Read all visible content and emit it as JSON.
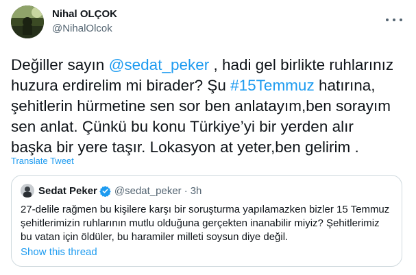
{
  "author": {
    "name": "Nihal OLÇOK",
    "handle": "@NihalOlcok"
  },
  "tweet": {
    "lines": [
      [
        {
          "t": "Değiller sayın ",
          "link": false
        },
        {
          "t": "@sedat_peker",
          "link": true
        },
        {
          "t": " , hadi gel birlikte ruhlarınız",
          "link": false
        }
      ],
      [
        {
          "t": "huzura erdirelim mi birader? Şu ",
          "link": false
        },
        {
          "t": "#15Temmuz",
          "link": true
        },
        {
          "t": " hatırına,",
          "link": false
        }
      ],
      [
        {
          "t": "şehitlerin hürmetine sen sor ben anlatayım,ben sorayım",
          "link": false
        }
      ],
      [
        {
          "t": "sen anlat. Çünkü bu konu Türkiye’yi bir yerden alır",
          "link": false
        }
      ],
      [
        {
          "t": "başka bir yere taşır. Lokasyon at  yeter,ben gelirim .",
          "link": false
        }
      ]
    ],
    "translate_label": "Translate Tweet"
  },
  "quote": {
    "name": "Sedat Peker",
    "handle": "@sedat_peker",
    "separator": "·",
    "time": "3h",
    "lines": [
      "27-delile rağmen bu kişilere karşı bir soruşturma yapılamazken bizler 15 Temmuz",
      "şehitlerimizin ruhlarının mutlu olduğuna gerçekten inanabilir miyiz? Şehitlerimiz",
      "bu vatan için öldüler, bu haramiler milleti soysun diye değil."
    ],
    "show_thread_label": "Show this thread"
  },
  "icons": {
    "more": "more-horizontal-icon",
    "verified": "verified-badge-icon"
  },
  "colors": {
    "link": "#1d9bf0",
    "text": "#0f1419",
    "secondary": "#536471",
    "border": "#cfd9de"
  }
}
